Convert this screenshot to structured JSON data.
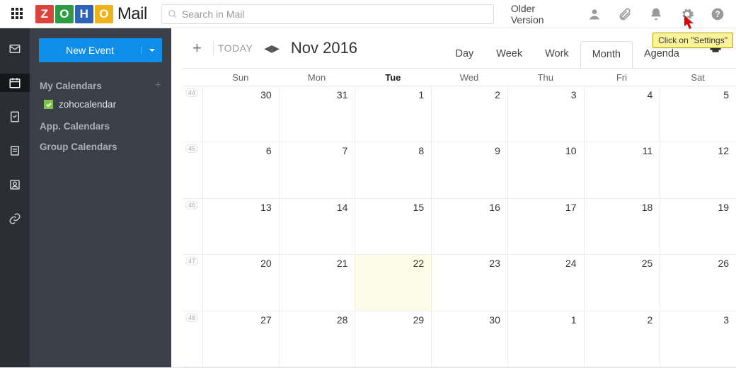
{
  "header": {
    "app_name_mail": "Mail",
    "logo_letters": [
      "Z",
      "O",
      "H",
      "O"
    ],
    "search_placeholder": "Search in Mail",
    "older_version": "Older Version",
    "callout_text": "Click on \"Settings\""
  },
  "sidebar": {
    "new_event": "New Event",
    "sections": {
      "my": "My Calendars",
      "app": "App. Calendars",
      "group": "Group Calendars"
    },
    "my_items": [
      {
        "label": "zohocalendar",
        "checked": true
      }
    ]
  },
  "calendar": {
    "today_label": "TODAY",
    "title": "Nov 2016",
    "views": [
      "Day",
      "Week",
      "Work",
      "Month",
      "Agenda"
    ],
    "active_view": "Month",
    "dow": [
      "Sun",
      "Mon",
      "Tue",
      "Wed",
      "Thu",
      "Fri",
      "Sat"
    ],
    "today_dow_index": 2,
    "weeks": [
      {
        "wn": 44,
        "days": [
          30,
          31,
          1,
          2,
          3,
          4,
          5
        ]
      },
      {
        "wn": 45,
        "days": [
          6,
          7,
          8,
          9,
          10,
          11,
          12
        ]
      },
      {
        "wn": 46,
        "days": [
          13,
          14,
          15,
          16,
          17,
          18,
          19
        ]
      },
      {
        "wn": 47,
        "days": [
          20,
          21,
          22,
          23,
          24,
          25,
          26
        ]
      },
      {
        "wn": 48,
        "days": [
          27,
          28,
          29,
          30,
          1,
          2,
          3
        ]
      }
    ],
    "today": {
      "week_index": 3,
      "day_index": 2
    }
  }
}
